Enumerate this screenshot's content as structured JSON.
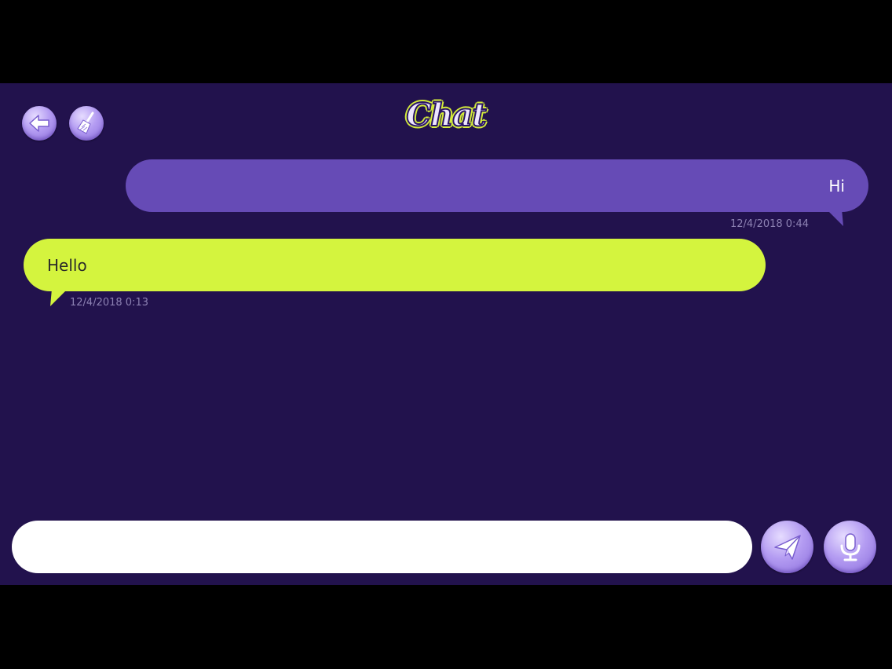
{
  "header": {
    "title": "Chat",
    "back_icon": "arrow-left-icon",
    "clear_icon": "broom-icon"
  },
  "messages": [
    {
      "direction": "outgoing",
      "text": "Hi",
      "timestamp": "12/4/2018 0:44",
      "color": "#664bb6"
    },
    {
      "direction": "incoming",
      "text": "Hello",
      "timestamp": "12/4/2018 0:13",
      "color": "#d4f43e"
    }
  ],
  "composer": {
    "value": "",
    "placeholder": "",
    "send_icon": "paper-plane-icon",
    "mic_icon": "microphone-icon"
  },
  "colors": {
    "background": "#22124d",
    "accent": "#664bb6",
    "highlight": "#d4f43e"
  }
}
